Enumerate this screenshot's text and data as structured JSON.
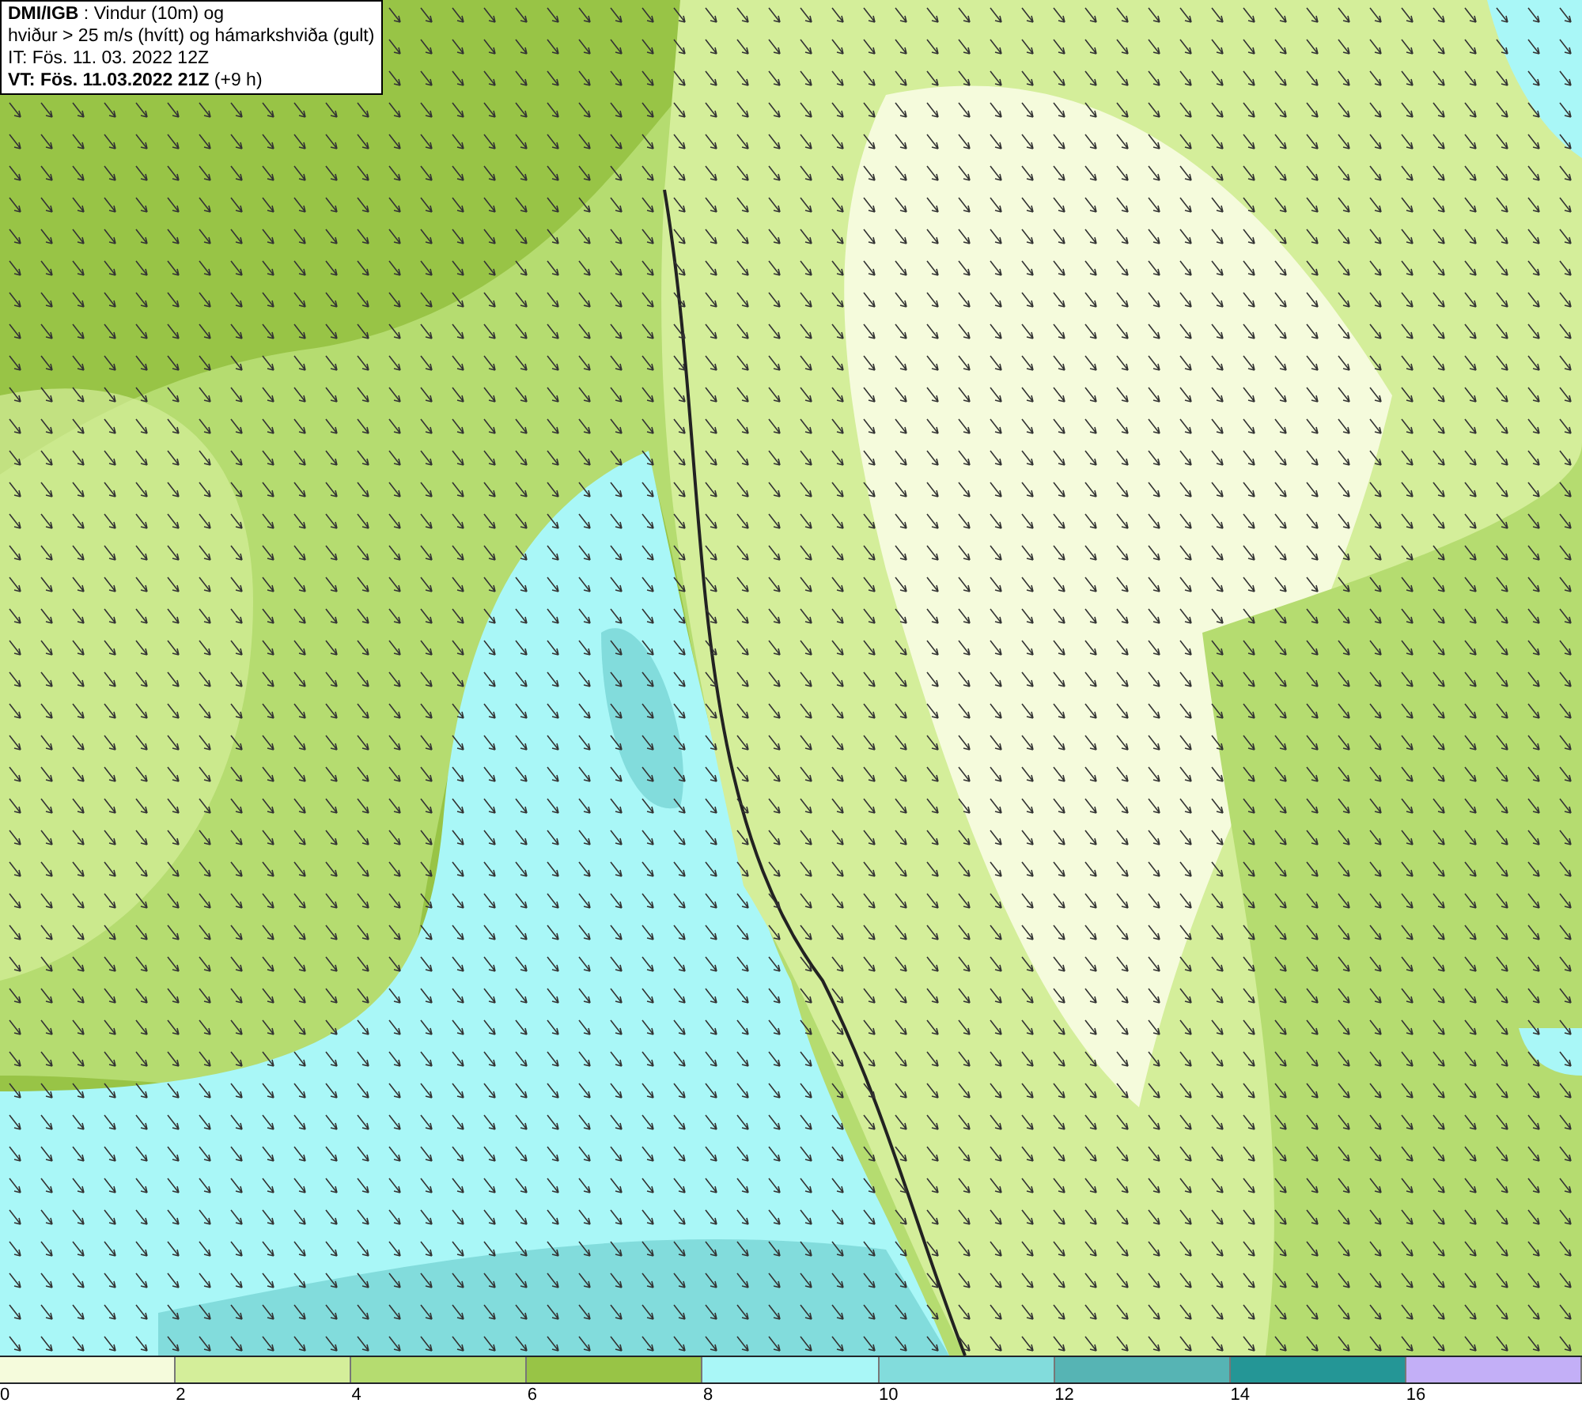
{
  "title_box": {
    "lines": [
      "**DMI/IGB** : Vindur (10m) og",
      "hviður > 25 m/s (hvítt) og hámarkshviða (gult)",
      "IT: Fös. 11. 03. 2022 12Z",
      "**VT: Fös. 11.03.2022 21Z** (+9 h)"
    ]
  },
  "legend": {
    "segments": [
      {
        "color": "#f5fbdc",
        "label": "0"
      },
      {
        "color": "#d4ee9a",
        "label": "2"
      },
      {
        "color": "#b5dc70",
        "label": "4"
      },
      {
        "color": "#98c446",
        "label": "6"
      },
      {
        "color": "#a9f7f7",
        "label": "8"
      },
      {
        "color": "#82dcdc",
        "label": "10"
      },
      {
        "color": "#56b4b4",
        "label": "12"
      },
      {
        "color": "#249696",
        "label": "14"
      },
      {
        "color": "#c3aff7",
        "label": "16"
      }
    ]
  }
}
